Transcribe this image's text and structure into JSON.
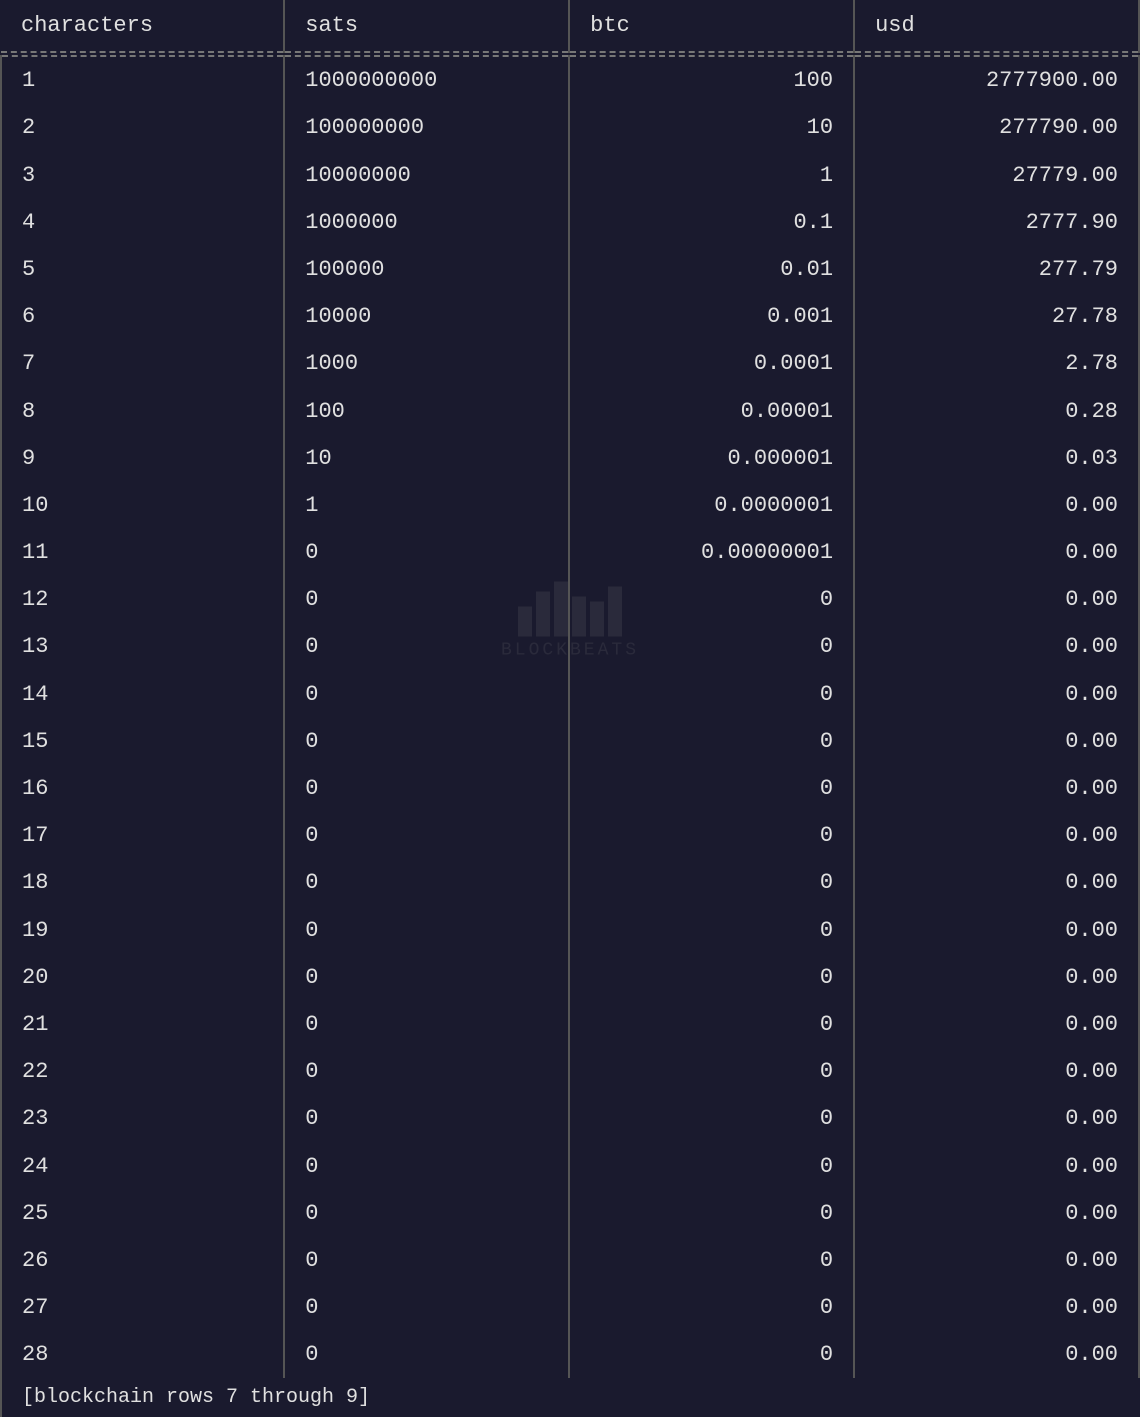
{
  "table": {
    "headers": [
      "characters",
      "sats",
      "btc",
      "usd"
    ],
    "rows": [
      {
        "chars": "1",
        "sats": "1000000000",
        "btc": "100",
        "usd": "2777900.00"
      },
      {
        "chars": "2",
        "sats": "100000000",
        "btc": "10",
        "usd": "277790.00"
      },
      {
        "chars": "3",
        "sats": "10000000",
        "btc": "1",
        "usd": "27779.00"
      },
      {
        "chars": "4",
        "sats": "1000000",
        "btc": "0.1",
        "usd": "2777.90"
      },
      {
        "chars": "5",
        "sats": "100000",
        "btc": "0.01",
        "usd": "277.79"
      },
      {
        "chars": "6",
        "sats": "10000",
        "btc": "0.001",
        "usd": "27.78"
      },
      {
        "chars": "7",
        "sats": "1000",
        "btc": "0.0001",
        "usd": "2.78"
      },
      {
        "chars": "8",
        "sats": "100",
        "btc": "0.00001",
        "usd": "0.28"
      },
      {
        "chars": "9",
        "sats": "10",
        "btc": "0.000001",
        "usd": "0.03"
      },
      {
        "chars": "10",
        "sats": "1",
        "btc": "0.0000001",
        "usd": "0.00"
      },
      {
        "chars": "11",
        "sats": "0",
        "btc": "0.00000001",
        "usd": "0.00"
      },
      {
        "chars": "12",
        "sats": "0",
        "btc": "0",
        "usd": "0.00"
      },
      {
        "chars": "13",
        "sats": "0",
        "btc": "0",
        "usd": "0.00"
      },
      {
        "chars": "14",
        "sats": "0",
        "btc": "0",
        "usd": "0.00"
      },
      {
        "chars": "15",
        "sats": "0",
        "btc": "0",
        "usd": "0.00"
      },
      {
        "chars": "16",
        "sats": "0",
        "btc": "0",
        "usd": "0.00"
      },
      {
        "chars": "17",
        "sats": "0",
        "btc": "0",
        "usd": "0.00"
      },
      {
        "chars": "18",
        "sats": "0",
        "btc": "0",
        "usd": "0.00"
      },
      {
        "chars": "19",
        "sats": "0",
        "btc": "0",
        "usd": "0.00"
      },
      {
        "chars": "20",
        "sats": "0",
        "btc": "0",
        "usd": "0.00"
      },
      {
        "chars": "21",
        "sats": "0",
        "btc": "0",
        "usd": "0.00"
      },
      {
        "chars": "22",
        "sats": "0",
        "btc": "0",
        "usd": "0.00"
      },
      {
        "chars": "23",
        "sats": "0",
        "btc": "0",
        "usd": "0.00"
      },
      {
        "chars": "24",
        "sats": "0",
        "btc": "0",
        "usd": "0.00"
      },
      {
        "chars": "25",
        "sats": "0",
        "btc": "0",
        "usd": "0.00"
      },
      {
        "chars": "26",
        "sats": "0",
        "btc": "0",
        "usd": "0.00"
      },
      {
        "chars": "27",
        "sats": "0",
        "btc": "0",
        "usd": "0.00"
      },
      {
        "chars": "28",
        "sats": "0",
        "btc": "0",
        "usd": "0.00"
      }
    ],
    "footer": "[blockchain rows 7 through 9]"
  },
  "watermark": {
    "text": "BLOCKBEATS"
  }
}
